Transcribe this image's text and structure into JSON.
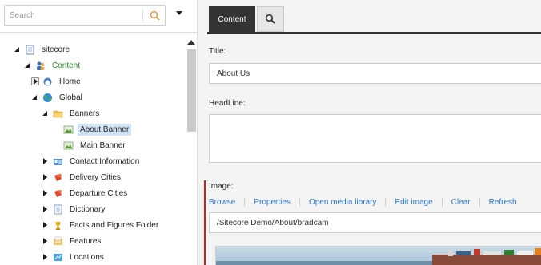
{
  "search": {
    "placeholder": "Search"
  },
  "tree": {
    "items": [
      {
        "label": "sitecore",
        "icon": "page-icon"
      },
      {
        "label": "Content",
        "icon": "people-icon"
      },
      {
        "label": "Home",
        "icon": "home-icon"
      },
      {
        "label": "Global",
        "icon": "globe-icon"
      },
      {
        "label": "Banners",
        "icon": "folder-icon"
      },
      {
        "label": "About Banner",
        "icon": "image-icon"
      },
      {
        "label": "Main Banner",
        "icon": "image-icon"
      },
      {
        "label": "Contact Information",
        "icon": "card-icon"
      },
      {
        "label": "Delivery Cities",
        "icon": "pins-icon"
      },
      {
        "label": "Departure Cities",
        "icon": "pins-icon"
      },
      {
        "label": "Dictionary",
        "icon": "doc-icon"
      },
      {
        "label": "Facts and Figures Folder",
        "icon": "trophy-icon"
      },
      {
        "label": "Features",
        "icon": "features-icon"
      },
      {
        "label": "Locations",
        "icon": "locations-icon"
      }
    ]
  },
  "tabs": {
    "content_label": "Content"
  },
  "fields": {
    "title_label": "Title:",
    "title_value": "About Us",
    "headline_label": "HeadLine:",
    "headline_value": "",
    "image_label": "Image:",
    "image_path": "/Sitecore Demo/About/bradcam"
  },
  "image_toolbar": {
    "browse": "Browse",
    "properties": "Properties",
    "open_media_library": "Open media library",
    "edit_image": "Edit image",
    "clear": "Clear",
    "refresh": "Refresh"
  },
  "colors": {
    "accent_link": "#2b74c7",
    "tab_active_bg": "#333333",
    "required_bar": "#cc1f1f",
    "selected_bg": "#cfe3f5"
  }
}
